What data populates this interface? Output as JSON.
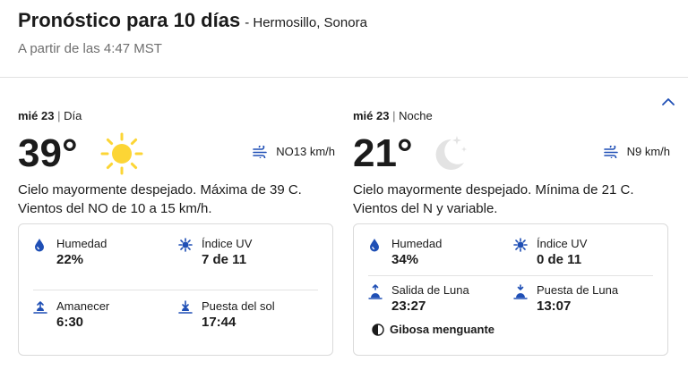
{
  "header": {
    "title": "Pronóstico para 10 días",
    "location": "- Hermosillo, Sonora",
    "updated": "A partir de las 4:47 MST"
  },
  "day": {
    "period_date": "mié 23",
    "period_sep": "|",
    "period_label": "Día",
    "temperature": "39°",
    "icon": "sun-icon",
    "wind": "NO13 km/h",
    "description": "Cielo mayormente despejado. Máxima de 39 C. Vientos del NO de 10 a 15 km/h.",
    "details": {
      "humidity_label": "Humedad",
      "humidity_value": "22%",
      "uv_label": "Índice UV",
      "uv_value": "7 de 11",
      "sunrise_label": "Amanecer",
      "sunrise_value": "6:30",
      "sunset_label": "Puesta del sol",
      "sunset_value": "17:44"
    }
  },
  "night": {
    "period_date": "mié 23",
    "period_sep": "|",
    "period_label": "Noche",
    "temperature": "21°",
    "icon": "moon-stars-icon",
    "wind": "N9 km/h",
    "description": "Cielo mayormente despejado. Mínima de 21 C. Vientos del N y variable.",
    "details": {
      "humidity_label": "Humedad",
      "humidity_value": "34%",
      "uv_label": "Índice UV",
      "uv_value": "0 de 11",
      "moonrise_label": "Salida de Luna",
      "moonrise_value": "23:27",
      "moonset_label": "Puesta de Luna",
      "moonset_value": "13:07",
      "moon_phase": "Gibosa menguante"
    }
  },
  "colors": {
    "accent_blue": "#1f4fb5",
    "sun_yellow": "#fcd535",
    "moon_gray": "#e3e3e3"
  }
}
